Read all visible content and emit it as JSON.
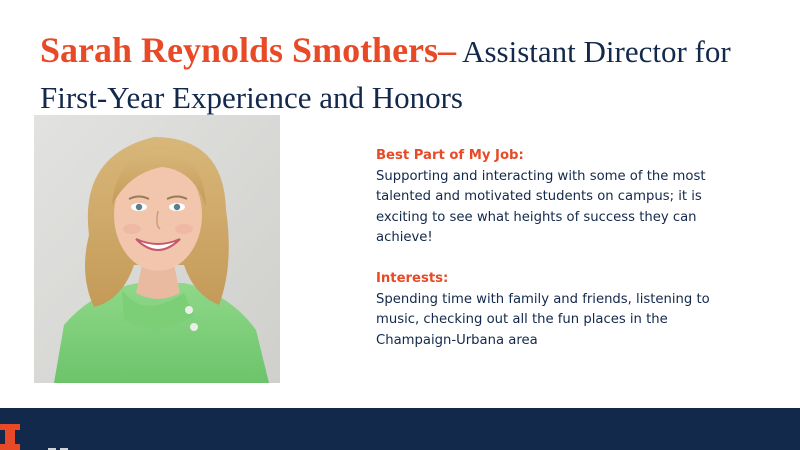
{
  "title": {
    "name": "Sarah Reynolds Smothers–",
    "role_line": " Assistant Director for First-Year Experience and Honors"
  },
  "sections": [
    {
      "heading": "Best Part of My Job:",
      "body": "Supporting and interacting with some of the most talented and motivated students on campus; it is exciting to see what heights of success they can achieve!"
    },
    {
      "heading": "Interests:",
      "body": "Spending time with family and friends, listening to music, checking out all the fun places in the Champaign-Urbana area"
    }
  ],
  "colors": {
    "orange": "#E84A27",
    "navy": "#13294B"
  },
  "icons": {
    "footer_logo": "block-i-logo"
  }
}
